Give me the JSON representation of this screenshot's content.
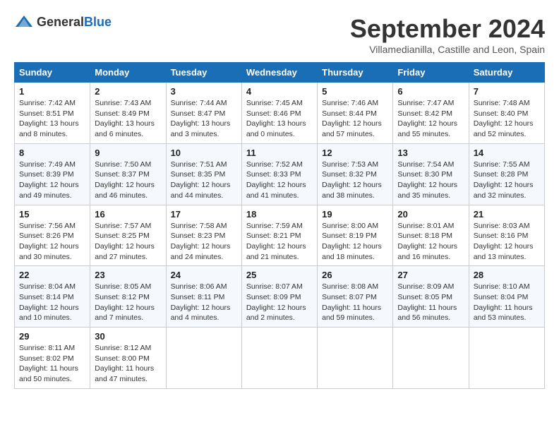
{
  "logo": {
    "text_general": "General",
    "text_blue": "Blue"
  },
  "title": "September 2024",
  "location": "Villamedianilla, Castille and Leon, Spain",
  "weekdays": [
    "Sunday",
    "Monday",
    "Tuesday",
    "Wednesday",
    "Thursday",
    "Friday",
    "Saturday"
  ],
  "weeks": [
    [
      {
        "day": "1",
        "sunrise": "7:42 AM",
        "sunset": "8:51 PM",
        "daylight": "13 hours and 8 minutes."
      },
      {
        "day": "2",
        "sunrise": "7:43 AM",
        "sunset": "8:49 PM",
        "daylight": "13 hours and 6 minutes."
      },
      {
        "day": "3",
        "sunrise": "7:44 AM",
        "sunset": "8:47 PM",
        "daylight": "13 hours and 3 minutes."
      },
      {
        "day": "4",
        "sunrise": "7:45 AM",
        "sunset": "8:46 PM",
        "daylight": "13 hours and 0 minutes."
      },
      {
        "day": "5",
        "sunrise": "7:46 AM",
        "sunset": "8:44 PM",
        "daylight": "12 hours and 57 minutes."
      },
      {
        "day": "6",
        "sunrise": "7:47 AM",
        "sunset": "8:42 PM",
        "daylight": "12 hours and 55 minutes."
      },
      {
        "day": "7",
        "sunrise": "7:48 AM",
        "sunset": "8:40 PM",
        "daylight": "12 hours and 52 minutes."
      }
    ],
    [
      {
        "day": "8",
        "sunrise": "7:49 AM",
        "sunset": "8:39 PM",
        "daylight": "12 hours and 49 minutes."
      },
      {
        "day": "9",
        "sunrise": "7:50 AM",
        "sunset": "8:37 PM",
        "daylight": "12 hours and 46 minutes."
      },
      {
        "day": "10",
        "sunrise": "7:51 AM",
        "sunset": "8:35 PM",
        "daylight": "12 hours and 44 minutes."
      },
      {
        "day": "11",
        "sunrise": "7:52 AM",
        "sunset": "8:33 PM",
        "daylight": "12 hours and 41 minutes."
      },
      {
        "day": "12",
        "sunrise": "7:53 AM",
        "sunset": "8:32 PM",
        "daylight": "12 hours and 38 minutes."
      },
      {
        "day": "13",
        "sunrise": "7:54 AM",
        "sunset": "8:30 PM",
        "daylight": "12 hours and 35 minutes."
      },
      {
        "day": "14",
        "sunrise": "7:55 AM",
        "sunset": "8:28 PM",
        "daylight": "12 hours and 32 minutes."
      }
    ],
    [
      {
        "day": "15",
        "sunrise": "7:56 AM",
        "sunset": "8:26 PM",
        "daylight": "12 hours and 30 minutes."
      },
      {
        "day": "16",
        "sunrise": "7:57 AM",
        "sunset": "8:25 PM",
        "daylight": "12 hours and 27 minutes."
      },
      {
        "day": "17",
        "sunrise": "7:58 AM",
        "sunset": "8:23 PM",
        "daylight": "12 hours and 24 minutes."
      },
      {
        "day": "18",
        "sunrise": "7:59 AM",
        "sunset": "8:21 PM",
        "daylight": "12 hours and 21 minutes."
      },
      {
        "day": "19",
        "sunrise": "8:00 AM",
        "sunset": "8:19 PM",
        "daylight": "12 hours and 18 minutes."
      },
      {
        "day": "20",
        "sunrise": "8:01 AM",
        "sunset": "8:18 PM",
        "daylight": "12 hours and 16 minutes."
      },
      {
        "day": "21",
        "sunrise": "8:03 AM",
        "sunset": "8:16 PM",
        "daylight": "12 hours and 13 minutes."
      }
    ],
    [
      {
        "day": "22",
        "sunrise": "8:04 AM",
        "sunset": "8:14 PM",
        "daylight": "12 hours and 10 minutes."
      },
      {
        "day": "23",
        "sunrise": "8:05 AM",
        "sunset": "8:12 PM",
        "daylight": "12 hours and 7 minutes."
      },
      {
        "day": "24",
        "sunrise": "8:06 AM",
        "sunset": "8:11 PM",
        "daylight": "12 hours and 4 minutes."
      },
      {
        "day": "25",
        "sunrise": "8:07 AM",
        "sunset": "8:09 PM",
        "daylight": "12 hours and 2 minutes."
      },
      {
        "day": "26",
        "sunrise": "8:08 AM",
        "sunset": "8:07 PM",
        "daylight": "11 hours and 59 minutes."
      },
      {
        "day": "27",
        "sunrise": "8:09 AM",
        "sunset": "8:05 PM",
        "daylight": "11 hours and 56 minutes."
      },
      {
        "day": "28",
        "sunrise": "8:10 AM",
        "sunset": "8:04 PM",
        "daylight": "11 hours and 53 minutes."
      }
    ],
    [
      {
        "day": "29",
        "sunrise": "8:11 AM",
        "sunset": "8:02 PM",
        "daylight": "11 hours and 50 minutes."
      },
      {
        "day": "30",
        "sunrise": "8:12 AM",
        "sunset": "8:00 PM",
        "daylight": "11 hours and 47 minutes."
      },
      null,
      null,
      null,
      null,
      null
    ]
  ]
}
